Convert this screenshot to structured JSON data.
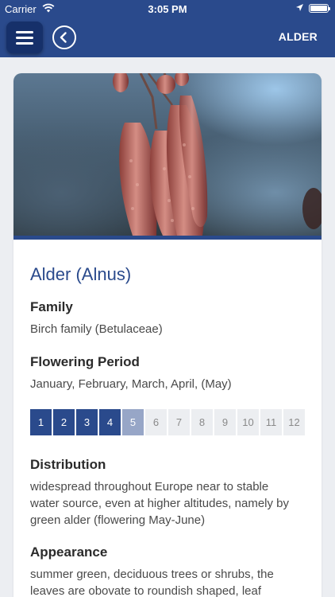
{
  "status_bar": {
    "carrier": "Carrier",
    "time": "3:05 PM"
  },
  "nav": {
    "title": "ALDER",
    "menu_icon": "hamburger-icon",
    "back_icon": "chevron-left-circle-icon"
  },
  "plant": {
    "name": "Alder (Alnus)",
    "image": "alder-catkins-photo",
    "family_heading": "Family",
    "family": "Birch family (Betulaceae)",
    "flowering_heading": "Flowering Period",
    "flowering": "January, February, March, April, (May)",
    "distribution_heading": "Distribution",
    "distribution": "widespread throughout Europe near to stable water source, even at higher altitudes, namely by green alder (flowering May-June)",
    "appearance_heading": "Appearance",
    "appearance": "summer green, deciduous trees or shrubs, the leaves are obovate to roundish shaped, leaf"
  },
  "months": [
    {
      "label": "1",
      "state": "on"
    },
    {
      "label": "2",
      "state": "on"
    },
    {
      "label": "3",
      "state": "on"
    },
    {
      "label": "4",
      "state": "on"
    },
    {
      "label": "5",
      "state": "partial"
    },
    {
      "label": "6",
      "state": "off"
    },
    {
      "label": "7",
      "state": "off"
    },
    {
      "label": "8",
      "state": "off"
    },
    {
      "label": "9",
      "state": "off"
    },
    {
      "label": "10",
      "state": "off"
    },
    {
      "label": "11",
      "state": "off"
    },
    {
      "label": "12",
      "state": "off"
    }
  ],
  "colors": {
    "brand": "#2a4a8c",
    "month_on": "#2a4a8c",
    "month_partial": "#97a6c7",
    "month_off": "#eceef1"
  }
}
